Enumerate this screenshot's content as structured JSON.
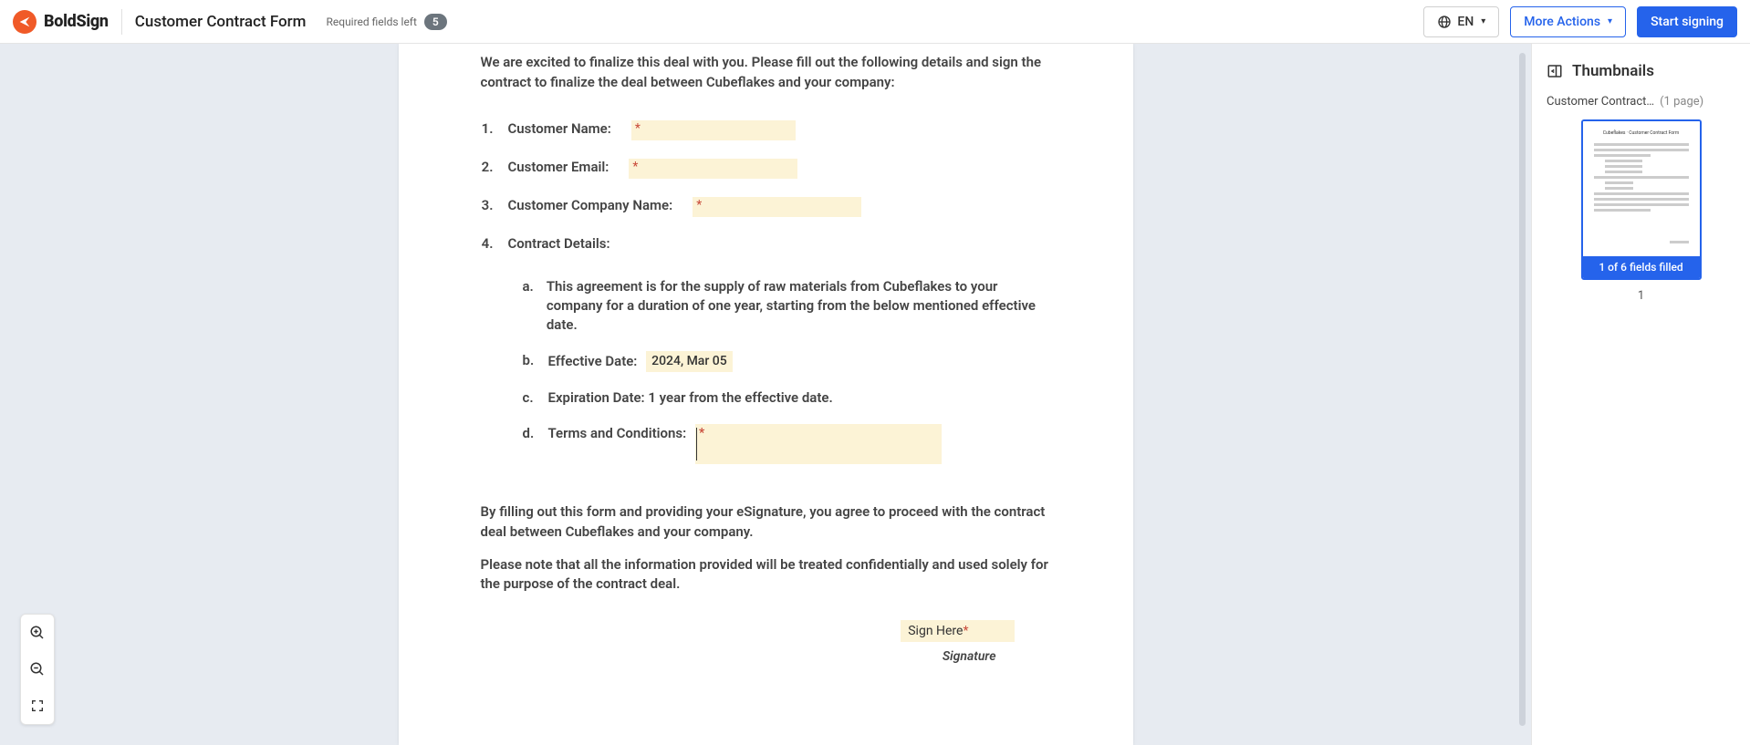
{
  "header": {
    "logo_text": "BoldSign",
    "doc_title": "Customer Contract Form",
    "required_label": "Required fields left",
    "required_count": "5",
    "lang_label": "EN",
    "more_actions": "More Actions",
    "start_signing": "Start signing"
  },
  "doc": {
    "intro": "We are excited to finalize this deal with you. Please fill out the following details and sign the contract to finalize the deal between Cubeflakes and your company:",
    "items": {
      "n1": "1.",
      "l1": "Customer Name:",
      "n2": "2.",
      "l2": "Customer Email:",
      "n3": "3.",
      "l3": "Customer Company Name:",
      "n4": "4.",
      "l4": "Contract Details:"
    },
    "sub": {
      "a": "a.",
      "a_text": "This agreement is for the supply of raw materials from Cubeflakes to your company for a duration of one year, starting from the below mentioned effective date.",
      "b": "b.",
      "b_label": "Effective Date:",
      "b_value": "2024, Mar 05",
      "c": "c.",
      "c_text": "Expiration Date: 1 year from the effective date.",
      "d": "d.",
      "d_label": "Terms and Conditions:"
    },
    "para1": "By filling out this form and providing your eSignature, you agree to proceed with the contract deal between Cubeflakes and your company.",
    "para2": "Please note that all the information provided will be treated confidentially and used solely for the purpose of the contract deal.",
    "sign_here": "Sign Here",
    "signature_cap": "Signature",
    "asterisk": "*"
  },
  "side": {
    "title": "Thumbnails",
    "doc_name": "Customer Contract…",
    "page_count": "(1 page)",
    "fields_filled": "1 of 6 fields filled",
    "page_num": "1"
  }
}
